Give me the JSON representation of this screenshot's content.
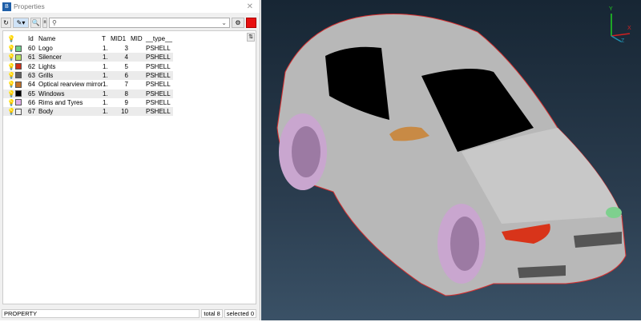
{
  "window": {
    "title": "Properties",
    "logo": "B"
  },
  "toolbar": {
    "search_placeholder": "",
    "icons": [
      "refresh-icon",
      "highlight-icon",
      "zoom-icon",
      "search-icon",
      "settings-icon",
      "color-icon"
    ]
  },
  "grid": {
    "columns": [
      "Id",
      "Name",
      "T",
      "MID1",
      "MID",
      "__type__"
    ],
    "rows": [
      {
        "id": "60",
        "name": "Logo",
        "t": "1.",
        "mid1": "3",
        "mid": "",
        "type": "PSHELL",
        "color": "#6fd08a"
      },
      {
        "id": "61",
        "name": "Silencer",
        "t": "1.",
        "mid1": "4",
        "mid": "",
        "type": "PSHELL",
        "color": "#b4e060"
      },
      {
        "id": "62",
        "name": "Lights",
        "t": "1.",
        "mid1": "5",
        "mid": "",
        "type": "PSHELL",
        "color": "#d03018"
      },
      {
        "id": "63",
        "name": "Grills",
        "t": "1.",
        "mid1": "6",
        "mid": "",
        "type": "PSHELL",
        "color": "#606060"
      },
      {
        "id": "64",
        "name": "Optical rearview mirror",
        "t": "1.",
        "mid1": "7",
        "mid": "",
        "type": "PSHELL",
        "color": "#c07028"
      },
      {
        "id": "65",
        "name": "Windows",
        "t": "1.",
        "mid1": "8",
        "mid": "",
        "type": "PSHELL",
        "color": "#000000"
      },
      {
        "id": "66",
        "name": "Rims and Tyres",
        "t": "1.",
        "mid1": "9",
        "mid": "",
        "type": "PSHELL",
        "color": "#e0b0e8"
      },
      {
        "id": "67",
        "name": "Body",
        "t": "1.",
        "mid1": "10",
        "mid": "",
        "type": "PSHELL",
        "color": "#f0f0f0"
      }
    ]
  },
  "status": {
    "mode": "PROPERTY",
    "total": "total 8",
    "selected": "selected 0"
  },
  "axes": {
    "y": "Y",
    "x": "X",
    "z": "Z"
  }
}
